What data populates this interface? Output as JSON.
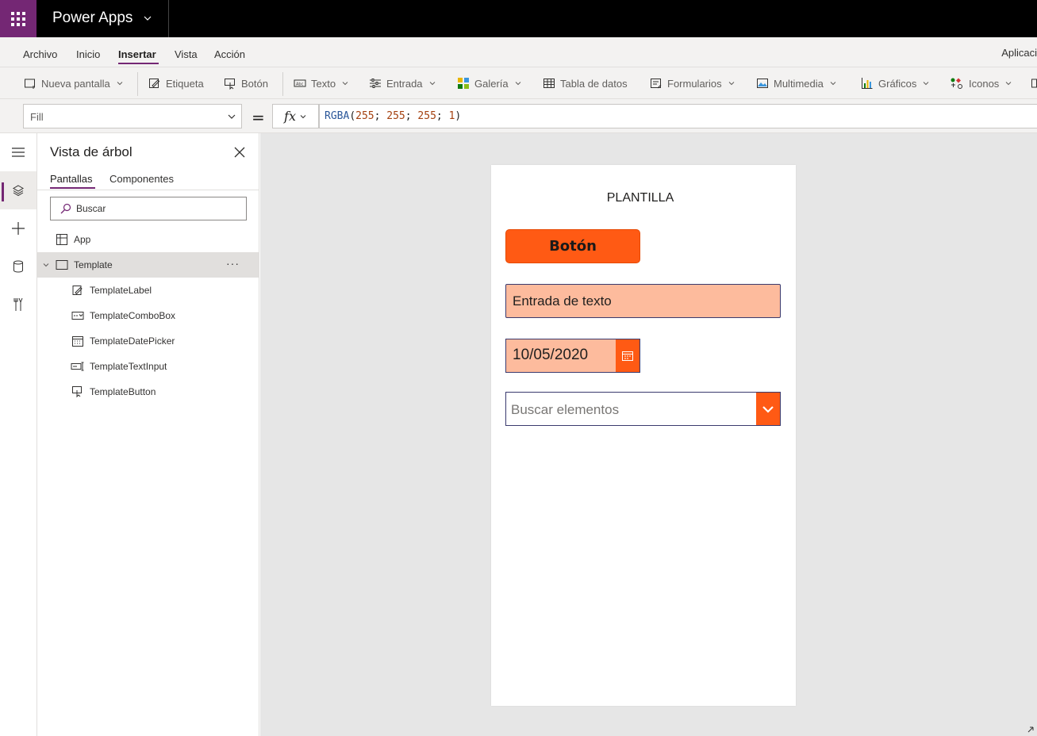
{
  "app": {
    "name": "Power Apps"
  },
  "menu": {
    "items": [
      "Archivo",
      "Inicio",
      "Insertar",
      "Vista",
      "Acción"
    ],
    "active": "Insertar",
    "right_label": "Aplicaci"
  },
  "ribbon": {
    "new_screen": "Nueva pantalla",
    "label": "Etiqueta",
    "button": "Botón",
    "text": "Texto",
    "input": "Entrada",
    "gallery": "Galería",
    "data_table": "Tabla de datos",
    "forms": "Formularios",
    "media": "Multimedia",
    "charts": "Gráficos",
    "icons": "Iconos"
  },
  "formula_bar": {
    "property": "Fill",
    "equals": "=",
    "fx": "fx",
    "formula": {
      "fn": "RGBA",
      "open": "(",
      "r": "255",
      "sep1": "; ",
      "g": "255",
      "sep2": "; ",
      "b": "255",
      "sep3": "; ",
      "a": "1",
      "close": ")"
    }
  },
  "tree_view": {
    "title": "Vista de árbol",
    "tabs": [
      "Pantallas",
      "Componentes"
    ],
    "active_tab": "Pantallas",
    "search_placeholder": "Buscar",
    "app_node": "App",
    "screen_node": "Template",
    "screen_more": "···",
    "children": [
      "TemplateLabel",
      "TemplateComboBox",
      "TemplateDatePicker",
      "TemplateTextInput",
      "TemplateButton"
    ]
  },
  "canvas": {
    "label_text": "PLANTILLA",
    "button_text": "Botón",
    "text_input_value": "Entrada de texto",
    "date_value": "10/05/2020",
    "combo_placeholder": "Buscar elementos"
  },
  "colors": {
    "brand": "#742774",
    "accent": "#ff5a14",
    "input_fill": "#fdbb9d",
    "border": "#3a3a6e"
  }
}
